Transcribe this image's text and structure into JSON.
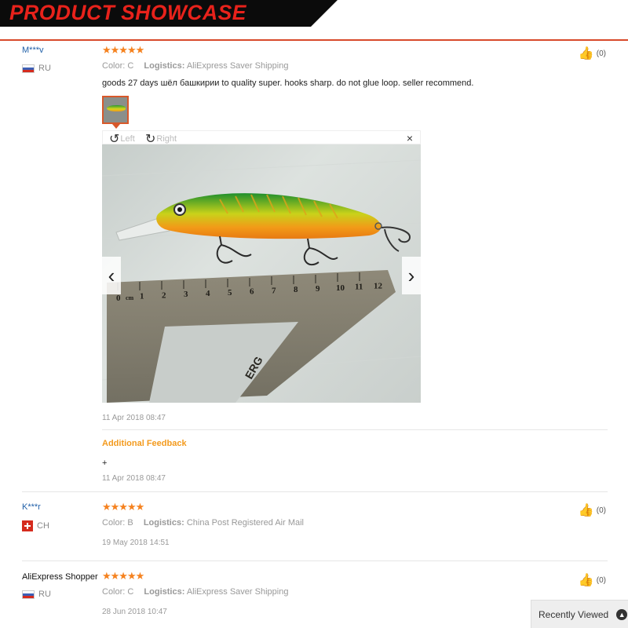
{
  "header": {
    "title": "PRODUCT SHOWCASE"
  },
  "reviews": [
    {
      "user": "M***v",
      "country": "RU",
      "stars": "★★★★★",
      "color_label": "Color:",
      "color_value": "C",
      "logistics_label": "Logistics:",
      "logistics_value": "AliExpress Saver Shipping",
      "text": "goods 27 days шёл башкирии to quality super. hooks sharp. do not glue loop. seller recommend.",
      "date": "11 Apr 2018 08:47",
      "likes": "(0)",
      "additional_feedback_label": "Additional Feedback",
      "additional_feedback_text": "+",
      "additional_feedback_date": "11 Apr 2018 08:47"
    },
    {
      "user": "K***r",
      "country": "CH",
      "stars": "★★★★★",
      "color_label": "Color:",
      "color_value": "B",
      "logistics_label": "Logistics:",
      "logistics_value": "China Post Registered Air Mail",
      "date": "19 May 2018 14:51",
      "likes": "(0)"
    },
    {
      "user": "AliExpress Shopper",
      "country": "RU",
      "stars": "★★★★★",
      "color_label": "Color:",
      "color_value": "C",
      "logistics_label": "Logistics:",
      "logistics_value": "AliExpress Saver Shipping",
      "date": "28 Jun 2018 10:47",
      "likes": "(0)"
    }
  ],
  "viewer": {
    "rotate_left_label": "Left",
    "rotate_right_label": "Right",
    "close_label": "×",
    "prev_label": "‹",
    "next_label": "›",
    "ruler_numbers": [
      "0",
      "cm",
      "1",
      "2",
      "3",
      "4",
      "5",
      "6",
      "7",
      "8",
      "9",
      "10",
      "11",
      "12"
    ],
    "ruler_brand": "ERG"
  },
  "recently_viewed": {
    "label": "Recently Viewed",
    "icon": "chevron-up-icon"
  },
  "colors": {
    "title_red": "#e8221b",
    "link_blue": "#1f5fa8",
    "star_orange": "#f5821f",
    "feedback_orange": "#f39a1d"
  }
}
